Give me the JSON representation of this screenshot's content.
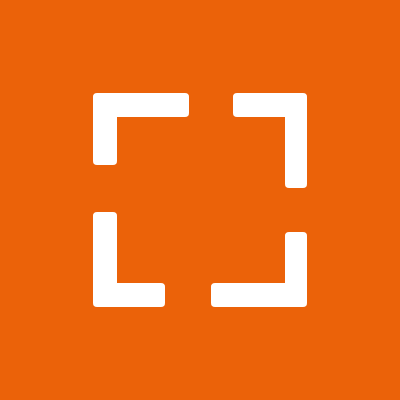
{
  "colors": {
    "background": "#EB6209",
    "glyph": "#FFFFFF"
  },
  "icon": {
    "name": "fullscreen-frame-icon"
  }
}
